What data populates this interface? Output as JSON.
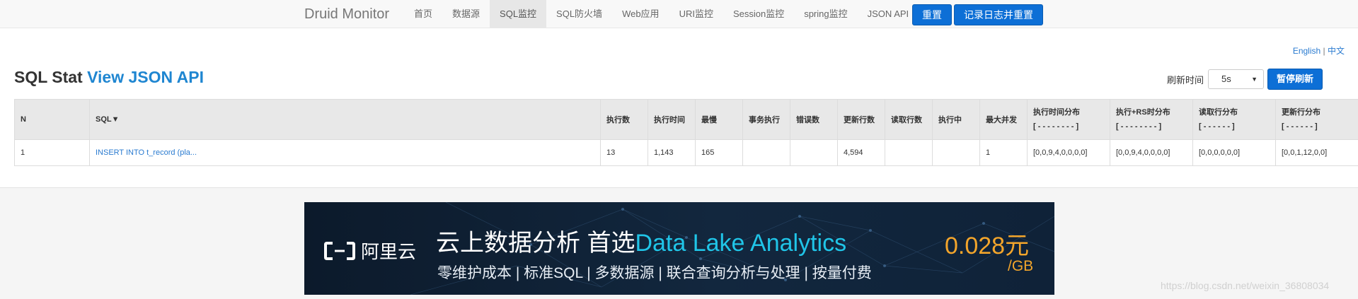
{
  "navbar": {
    "brand": "Druid Monitor",
    "items": [
      "首页",
      "数据源",
      "SQL监控",
      "SQL防火墙",
      "Web应用",
      "URI监控",
      "Session监控",
      "spring监控",
      "JSON API"
    ],
    "active_index": 2,
    "reset_label": "重置",
    "log_reset_label": "记录日志并重置"
  },
  "lang": {
    "english": "English",
    "separator": "|",
    "chinese": "中文"
  },
  "page": {
    "title": "SQL Stat",
    "json_link": "View JSON API"
  },
  "refresh": {
    "label": "刷新时间",
    "value": "5s",
    "pause_label": "暂停刷新"
  },
  "table": {
    "columns": [
      {
        "line1": "N",
        "line2": ""
      },
      {
        "line1": "SQL▼",
        "line2": ""
      },
      {
        "line1": "执行数",
        "line2": ""
      },
      {
        "line1": "执行时间",
        "line2": ""
      },
      {
        "line1": "最慢",
        "line2": ""
      },
      {
        "line1": "事务执行",
        "line2": ""
      },
      {
        "line1": "错误数",
        "line2": ""
      },
      {
        "line1": "更新行数",
        "line2": ""
      },
      {
        "line1": "读取行数",
        "line2": ""
      },
      {
        "line1": "执行中",
        "line2": ""
      },
      {
        "line1": "最大并发",
        "line2": ""
      },
      {
        "line1": "执行时间分布",
        "line2": "[ - - - - - - - - ]"
      },
      {
        "line1": "执行+RS时分布",
        "line2": "[ - - - - - - - - ]"
      },
      {
        "line1": "读取行分布",
        "line2": "[ - - - - - - ]"
      },
      {
        "line1": "更新行分布",
        "line2": "[ - - - - - - ]"
      }
    ],
    "rows": [
      [
        "1",
        "INSERT INTO t_record (pla...",
        "13",
        "1,143",
        "165",
        "",
        "",
        "4,594",
        "",
        "",
        "1",
        "[0,0,9,4,0,0,0,0]",
        "[0,0,9,4,0,0,0,0]",
        "[0,0,0,0,0,0]",
        "[0,0,1,12,0,0]"
      ]
    ]
  },
  "banner": {
    "logo_text": "阿里云",
    "headline_prefix": "云上数据分析 首选",
    "headline_highlight": "Data Lake Analytics",
    "subline": "零维护成本 | 标准SQL | 多数据源 | 联合查询分析与处理 | 按量付费",
    "price": "0.028元",
    "unit": "/GB"
  },
  "watermark": "https://blog.csdn.net/weixin_36808034",
  "colors": {
    "primary": "#0d6fd6",
    "link": "#1f86d1",
    "banner_accent": "#20c5e8",
    "price": "#f3a52b"
  }
}
